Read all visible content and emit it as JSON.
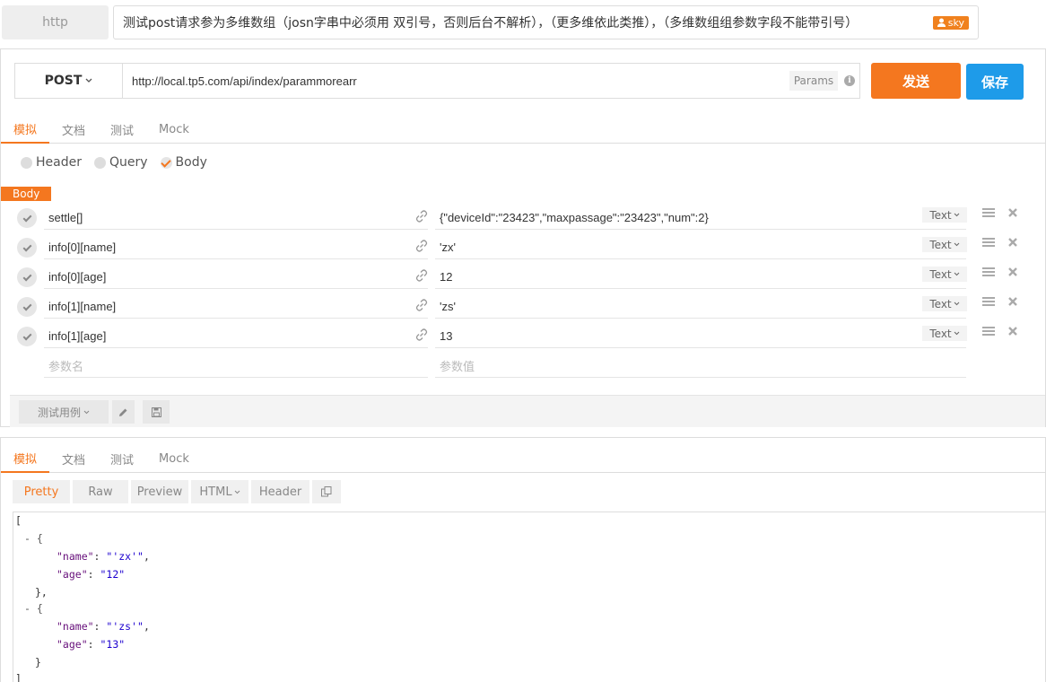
{
  "header": {
    "protocol_label": "http",
    "api_title": "测试post请求参为多维数组（josn字串中必须用 双引号，否则后台不解析），（更多维依此类推），（多维数组组参数字段不能带引号）",
    "user": "sky"
  },
  "request": {
    "method": "POST",
    "url": "http://local.tp5.com/api/index/parammorearr",
    "params_label": "Params",
    "send_label": "发送",
    "save_label": "保存",
    "tabs": [
      "模拟",
      "文档",
      "测试",
      "Mock"
    ],
    "active_tab": "模拟",
    "radios": [
      {
        "label": "Header",
        "checked": false
      },
      {
        "label": "Query",
        "checked": false
      },
      {
        "label": "Body",
        "checked": true
      }
    ],
    "body_label": "Body",
    "params": [
      {
        "name": "settle[]",
        "value": "{\"deviceId\":\"23423\",\"maxpassage\":\"23423\",\"num\":2}",
        "type": "Text"
      },
      {
        "name": "info[0][name]",
        "value": "'zx'",
        "type": "Text"
      },
      {
        "name": "info[0][age]",
        "value": "12",
        "type": "Text"
      },
      {
        "name": "info[1][name]",
        "value": "'zs'",
        "type": "Text"
      },
      {
        "name": "info[1][age]",
        "value": "13",
        "type": "Text"
      }
    ],
    "name_placeholder": "参数名",
    "value_placeholder": "参数值",
    "test_case_label": "测试用例"
  },
  "response": {
    "tabs": [
      "模拟",
      "文档",
      "测试",
      "Mock"
    ],
    "active_tab": "模拟",
    "views": [
      "Pretty",
      "Raw",
      "Preview",
      "HTML",
      "Header"
    ],
    "active_view": "Pretty",
    "json_lines": [
      {
        "text": "[",
        "indent": 0
      },
      {
        "text": "- {",
        "indent": 1,
        "collapse": true
      },
      {
        "key": "\"name\"",
        "value": "\"'zx'\"",
        "comma": true,
        "indent": 2
      },
      {
        "key": "\"age\"",
        "value": "\"12\"",
        "comma": false,
        "indent": 2
      },
      {
        "text": "},",
        "indent": 1.5
      },
      {
        "text": "- {",
        "indent": 1,
        "collapse": true
      },
      {
        "key": "\"name\"",
        "value": "\"'zs'\"",
        "comma": true,
        "indent": 2
      },
      {
        "key": "\"age\"",
        "value": "\"13\"",
        "comma": false,
        "indent": 2
      },
      {
        "text": "}",
        "indent": 1.5
      },
      {
        "text": "]",
        "indent": 0
      }
    ]
  },
  "colors": {
    "accent": "#f4771f",
    "primary": "#1e9be9"
  }
}
